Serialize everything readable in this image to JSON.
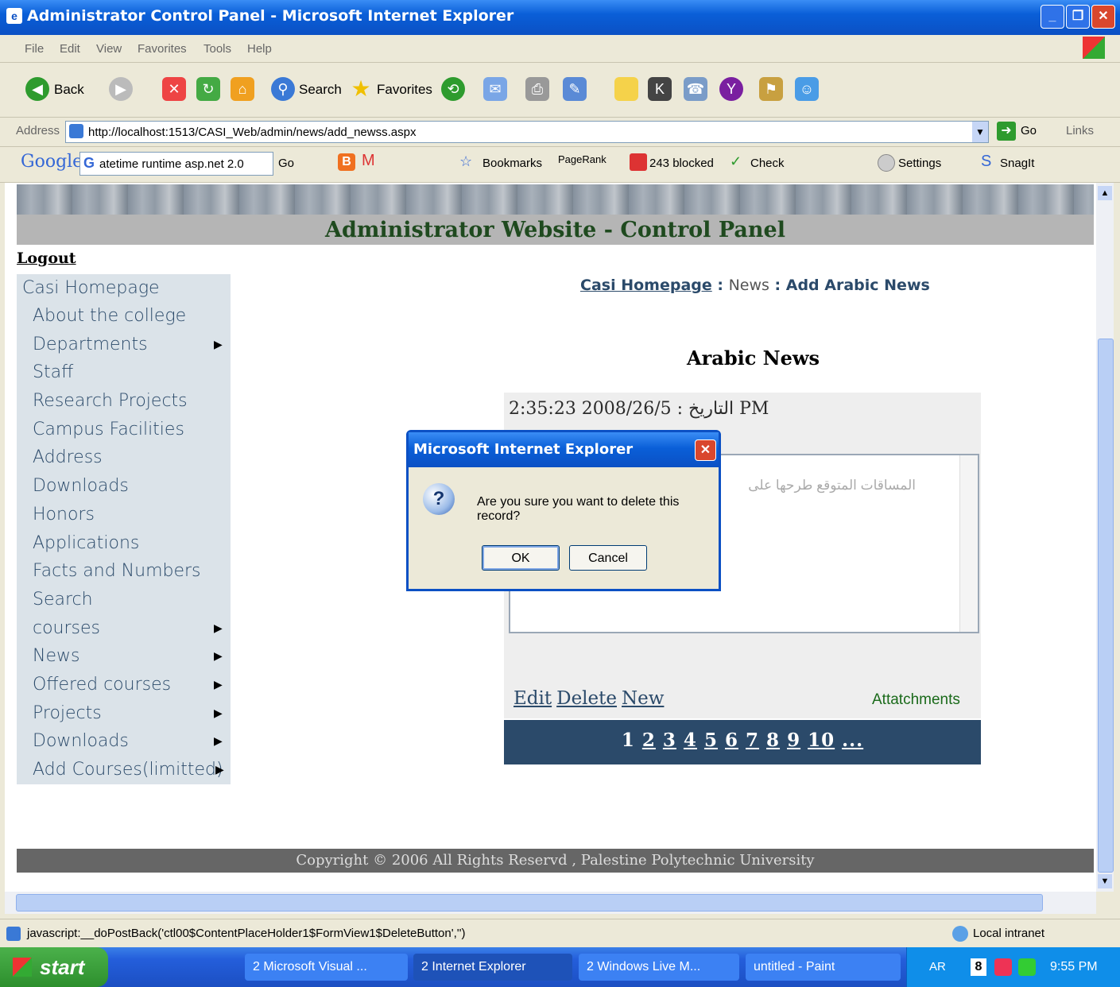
{
  "window": {
    "title": "Administrator Control Panel - Microsoft Internet Explorer",
    "minimize": "_",
    "maximize": "❐",
    "close": "✕"
  },
  "menu": [
    "File",
    "Edit",
    "View",
    "Favorites",
    "Tools",
    "Help"
  ],
  "toolbar": {
    "back": "Back",
    "search": "Search",
    "favorites": "Favorites"
  },
  "address": {
    "label": "Address",
    "url": "http://localhost:1513/CASI_Web/admin/news/add_newss.aspx",
    "go": "Go",
    "links": "Links"
  },
  "googlebar": {
    "logo": "Google",
    "search_text": "atetime runtime asp.net 2.0",
    "go": "Go",
    "bookmarks": "Bookmarks",
    "pagerank": "PageRank",
    "blocked": "243 blocked",
    "check": "Check",
    "settings": "Settings",
    "snagit": "SnagIt"
  },
  "page": {
    "banner_title": "Administrator Website - Control Panel",
    "logout": "Logout",
    "breadcrumb": {
      "home": "Casi Homepage",
      "sep1": " : ",
      "news": "News",
      "sep2": " : ",
      "current": "Add Arabic News"
    },
    "heading": "Arabic News",
    "date_line": "2:35:23 2008/26/5 : التاريخ PM",
    "textarea_text": "المساقات المتوقع طرحها على",
    "links": {
      "edit": "Edit",
      "delete": "Delete",
      "new": "New"
    },
    "attachments": "Attatchments",
    "pager": [
      "1",
      "2",
      "3",
      "4",
      "5",
      "6",
      "7",
      "8",
      "9",
      "10",
      "..."
    ],
    "footer": "Copyright © 2006 All Rights Reservd , Palestine Polytechnic University"
  },
  "sidenav": [
    {
      "label": "Casi Homepage",
      "arrow": ""
    },
    {
      "label": "About the college",
      "arrow": ""
    },
    {
      "label": "Departments",
      "arrow": "▶"
    },
    {
      "label": "Staff",
      "arrow": ""
    },
    {
      "label": "Research Projects",
      "arrow": ""
    },
    {
      "label": "Campus Facilities",
      "arrow": ""
    },
    {
      "label": "Address",
      "arrow": ""
    },
    {
      "label": "Downloads",
      "arrow": ""
    },
    {
      "label": "Honors",
      "arrow": ""
    },
    {
      "label": "Applications",
      "arrow": ""
    },
    {
      "label": "Facts and Numbers",
      "arrow": ""
    },
    {
      "label": "Search",
      "arrow": ""
    },
    {
      "label": "courses",
      "arrow": "▶"
    },
    {
      "label": "News",
      "arrow": "▶"
    },
    {
      "label": "Offered courses",
      "arrow": "▶"
    },
    {
      "label": "Projects",
      "arrow": "▶"
    },
    {
      "label": "Downloads",
      "arrow": "▶"
    },
    {
      "label": "Add Courses(limitted)",
      "arrow": "▶"
    }
  ],
  "dialog": {
    "title": "Microsoft Internet Explorer",
    "message": "Are you sure you want to delete this record?",
    "ok": "OK",
    "cancel": "Cancel",
    "icon": "question-icon"
  },
  "status": {
    "text": "javascript:__doPostBack('ctl00$ContentPlaceHolder1$FormView1$DeleteButton','')",
    "zone": "Local intranet"
  },
  "taskbar": {
    "start": "start",
    "buttons": [
      "2 Microsoft Visual ...",
      "2 Internet Explorer",
      "2 Windows Live M...",
      "untitled - Paint"
    ],
    "lang": "AR",
    "clock": "9:55 PM"
  }
}
